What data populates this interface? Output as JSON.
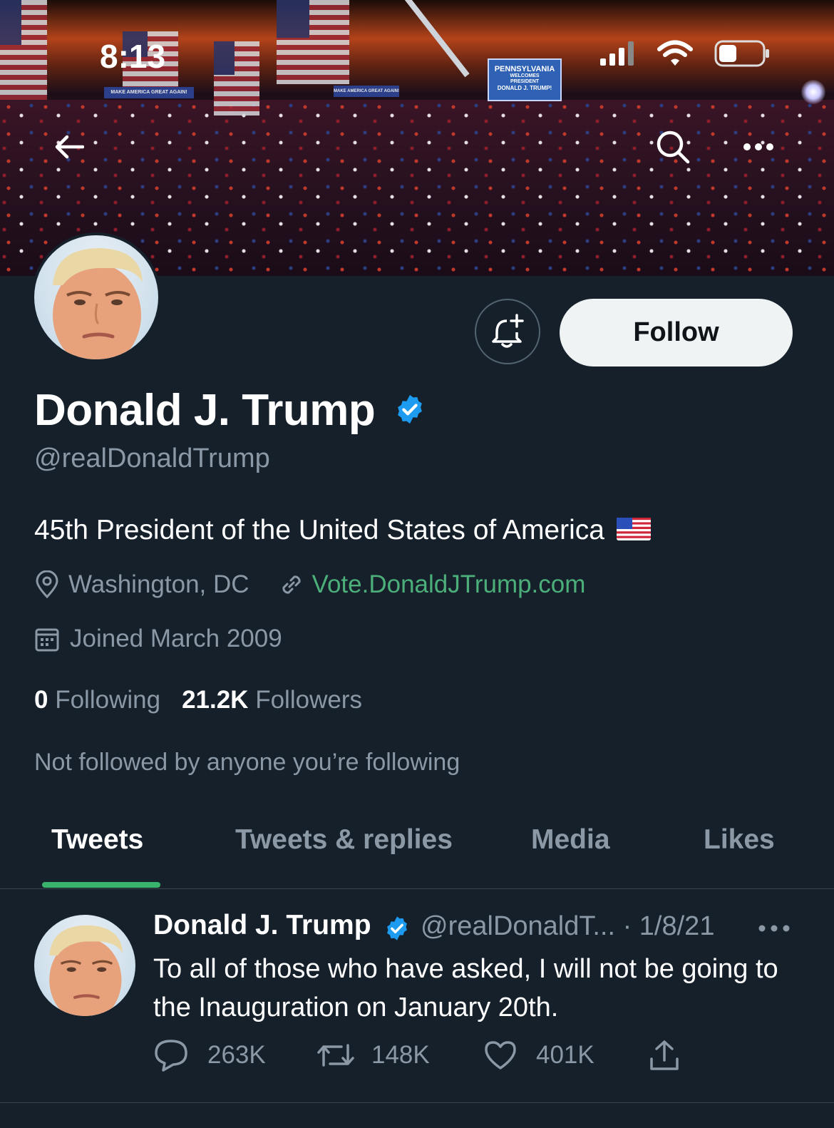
{
  "status_bar": {
    "time": "8:13"
  },
  "banner": {
    "signs": {
      "left": "MAKE AMERICA GREAT AGAIN!",
      "middle": "MAKE AMERICA GREAT AGAIN!",
      "right_lines": [
        "PENNSYLVANIA",
        "WELCOMES",
        "PRESIDENT",
        "DONALD J. TRUMP!"
      ]
    }
  },
  "profile": {
    "name": "Donald J. Trump",
    "handle": "@realDonaldTrump",
    "bio": "45th President of the United States of America",
    "location": "Washington, DC",
    "website": "Vote.DonaldJTrump.com",
    "joined": "Joined March 2009",
    "following_count": "0",
    "following_label": "Following",
    "followers_count": "21.2K",
    "followers_label": "Followers",
    "not_followed_text": "Not followed by anyone you’re following",
    "follow_button": "Follow"
  },
  "tabs": [
    {
      "label": "Tweets",
      "active": true
    },
    {
      "label": "Tweets & replies",
      "active": false
    },
    {
      "label": "Media",
      "active": false
    },
    {
      "label": "Likes",
      "active": false
    }
  ],
  "tweet": {
    "author": "Donald J. Trump",
    "handle_date": "@realDonaldT... · 1/8/21",
    "text": "To all of those who have asked, I will not be going to the Inauguration on January 20th.",
    "replies": "263K",
    "retweets": "148K",
    "likes": "401K"
  },
  "colors": {
    "background": "#15202b",
    "accent_link": "#4caf7a",
    "tab_indicator": "#39b36b",
    "verified": "#1d9bf0",
    "muted_text": "#8b98a5"
  },
  "icons": [
    "back-arrow-icon",
    "search-icon",
    "more-icon",
    "bell-plus-icon",
    "verified-badge-icon",
    "location-pin-icon",
    "link-icon",
    "calendar-icon",
    "reply-icon",
    "retweet-icon",
    "like-icon",
    "share-icon",
    "us-flag-emoji"
  ]
}
